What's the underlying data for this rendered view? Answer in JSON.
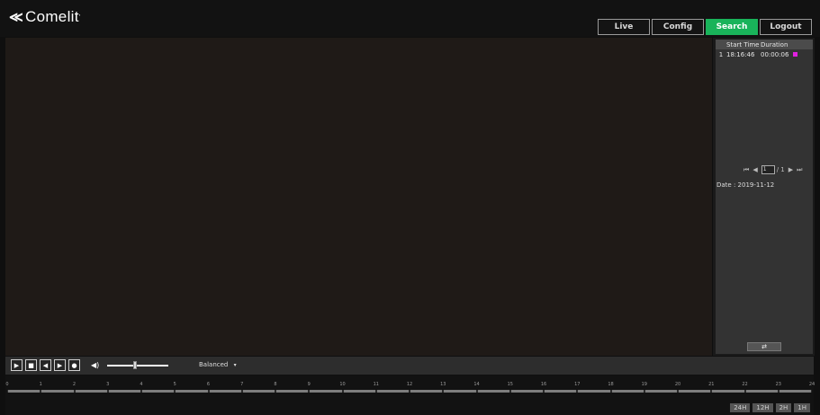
{
  "header": {
    "logo_mark": "≪",
    "logo_text": "Comelit",
    "logo_suffix": "'"
  },
  "tabs": [
    {
      "label": "Live",
      "active": false
    },
    {
      "label": "Config",
      "active": false
    },
    {
      "label": "Search",
      "active": true
    },
    {
      "label": "Logout",
      "active": false
    }
  ],
  "records": {
    "headers": [
      "Start Time",
      "Duration"
    ],
    "rows": [
      {
        "index": "1",
        "start_time": "18:16:46",
        "duration": "00:00:06",
        "marker_color": "#e020e0"
      }
    ]
  },
  "pager": {
    "first_icon": "⏮",
    "prev_icon": "◀",
    "current_page": "1",
    "total": "/ 1",
    "next_icon": "▶",
    "last_icon": "⏭"
  },
  "date_label": "Date : 2019-11-12",
  "switch_icon": "⇄",
  "controls": {
    "play_icon": "▶",
    "stop_icon": "■",
    "prev_frame_icon": "◀",
    "next_frame_icon": "▶",
    "snapshot_icon": "●",
    "volume_icon": "◀)",
    "quality": "Balanced",
    "quality_arrow": "▾",
    "volume_level": 0.45
  },
  "timeline": {
    "hours": [
      "0",
      "1",
      "2",
      "3",
      "4",
      "5",
      "6",
      "7",
      "8",
      "9",
      "10",
      "11",
      "12",
      "13",
      "14",
      "15",
      "16",
      "17",
      "18",
      "19",
      "20",
      "21",
      "22",
      "23",
      "24"
    ],
    "zoom_buttons": [
      "24H",
      "12H",
      "2H",
      "1H"
    ]
  },
  "colors": {
    "accent": "#19b35a",
    "record_marker": "#e020e0"
  }
}
